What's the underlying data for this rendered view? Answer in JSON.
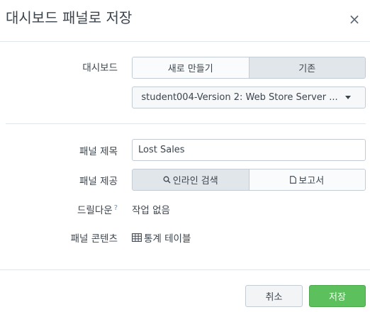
{
  "dialog": {
    "title": "대시보드 패널로 저장",
    "close_symbol": "×"
  },
  "dashboard": {
    "label": "대시보드",
    "options": [
      "새로 만들기",
      "기존"
    ],
    "selected": "기존",
    "selected_dashboard": "student004-Version 2: Web Store Server ..."
  },
  "panel_title": {
    "label": "패널 제목",
    "value": "Lost Sales"
  },
  "panel_powered_by": {
    "label": "패널 제공",
    "options": [
      "인라인 검색",
      "보고서"
    ],
    "selected": "인라인 검색"
  },
  "drilldown": {
    "label": "드릴다운",
    "help": "?",
    "value": "작업 없음"
  },
  "panel_content": {
    "label": "패널 콘텐츠",
    "value": "통계 테이블"
  },
  "footer": {
    "cancel_label": "취소",
    "save_label": "저장"
  },
  "colors": {
    "primary": "#5cc05c",
    "active_segment": "#e1e6eb",
    "help_link": "#5a8fd6"
  },
  "icons": {
    "search": "search-icon",
    "report": "report-icon",
    "table": "table-icon",
    "caret": "chevron-down-icon"
  }
}
